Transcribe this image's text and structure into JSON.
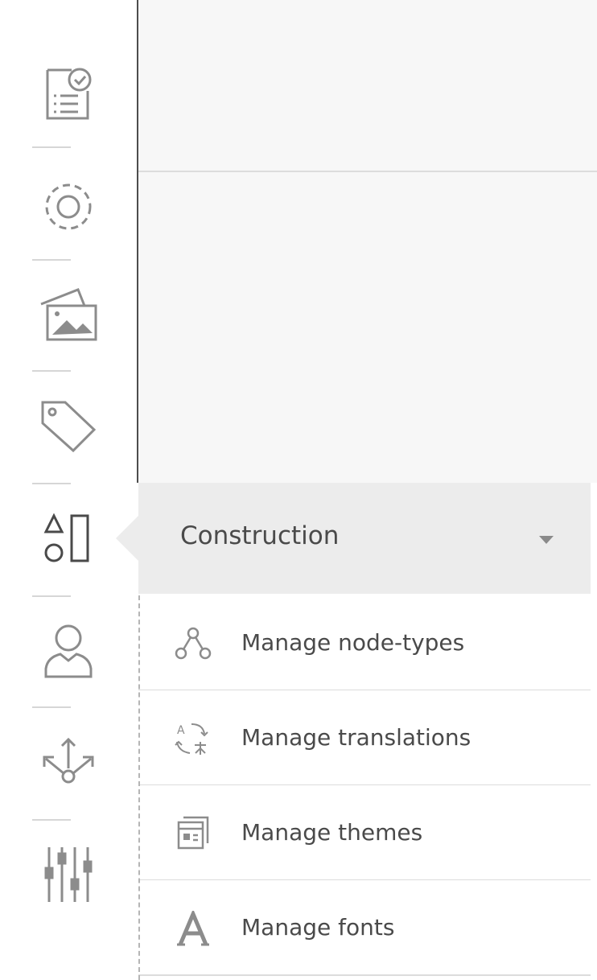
{
  "sidebar": {
    "icons": [
      {
        "name": "checklist-icon"
      },
      {
        "name": "target-icon"
      },
      {
        "name": "images-icon"
      },
      {
        "name": "tag-icon"
      },
      {
        "name": "shapes-icon"
      },
      {
        "name": "user-icon"
      },
      {
        "name": "network-icon"
      },
      {
        "name": "sliders-icon"
      }
    ]
  },
  "submenu": {
    "title": "Construction",
    "items": [
      {
        "label": "Manage node-types",
        "icon": "node-types-icon"
      },
      {
        "label": "Manage translations",
        "icon": "translations-icon"
      },
      {
        "label": "Manage themes",
        "icon": "themes-icon"
      },
      {
        "label": "Manage fonts",
        "icon": "fonts-icon"
      }
    ]
  }
}
